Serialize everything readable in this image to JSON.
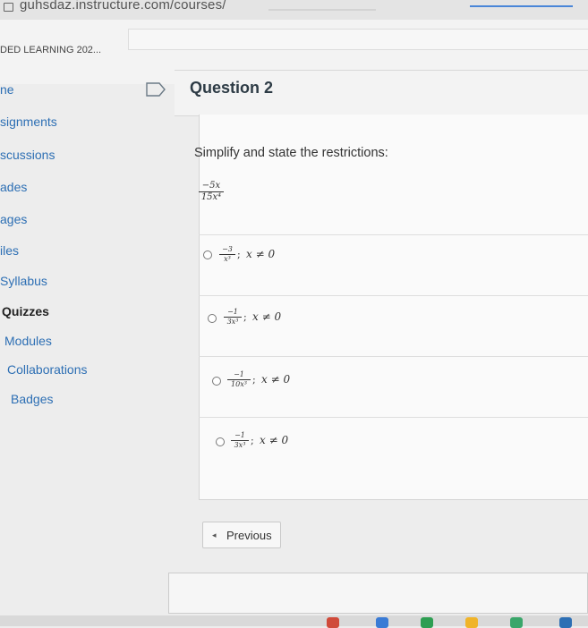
{
  "browser": {
    "url_fragment": "guhsdaz.instructure.com/courses/"
  },
  "course": {
    "title": "DED LEARNING 202..."
  },
  "sidebar": {
    "items": [
      {
        "label": "ne",
        "active": false
      },
      {
        "label": "signments",
        "active": false
      },
      {
        "label": "scussions",
        "active": false
      },
      {
        "label": "ades",
        "active": false
      },
      {
        "label": "ages",
        "active": false
      },
      {
        "label": "iles",
        "active": false
      },
      {
        "label": "Syllabus",
        "active": false
      },
      {
        "label": "Quizzes",
        "active": true
      },
      {
        "label": "Modules",
        "active": false
      },
      {
        "label": "Collaborations",
        "active": false
      },
      {
        "label": "Badges",
        "active": false
      }
    ]
  },
  "question": {
    "title": "Question 2",
    "prompt": "Simplify and state the restrictions:",
    "expression": {
      "numerator": "−5x",
      "denominator": "15x⁴"
    },
    "answers": [
      {
        "numerator": "−3",
        "denominator": "x³",
        "separator": ";",
        "restriction": "x ≠ 0"
      },
      {
        "numerator": "−1",
        "denominator": "3x³",
        "separator": ";",
        "restriction": "x ≠ 0"
      },
      {
        "numerator": "−1",
        "denominator": "10x³",
        "separator": ";",
        "restriction": "x ≠ 0"
      },
      {
        "numerator": "−1",
        "denominator": "3x³",
        "separator": ";",
        "restriction": "x ≠ 0"
      }
    ]
  },
  "navigation": {
    "previous_label": "Previous"
  },
  "colors": {
    "link": "#2d6fb4",
    "text": "#2d3b45",
    "tab_accent": "#4a86d8"
  }
}
